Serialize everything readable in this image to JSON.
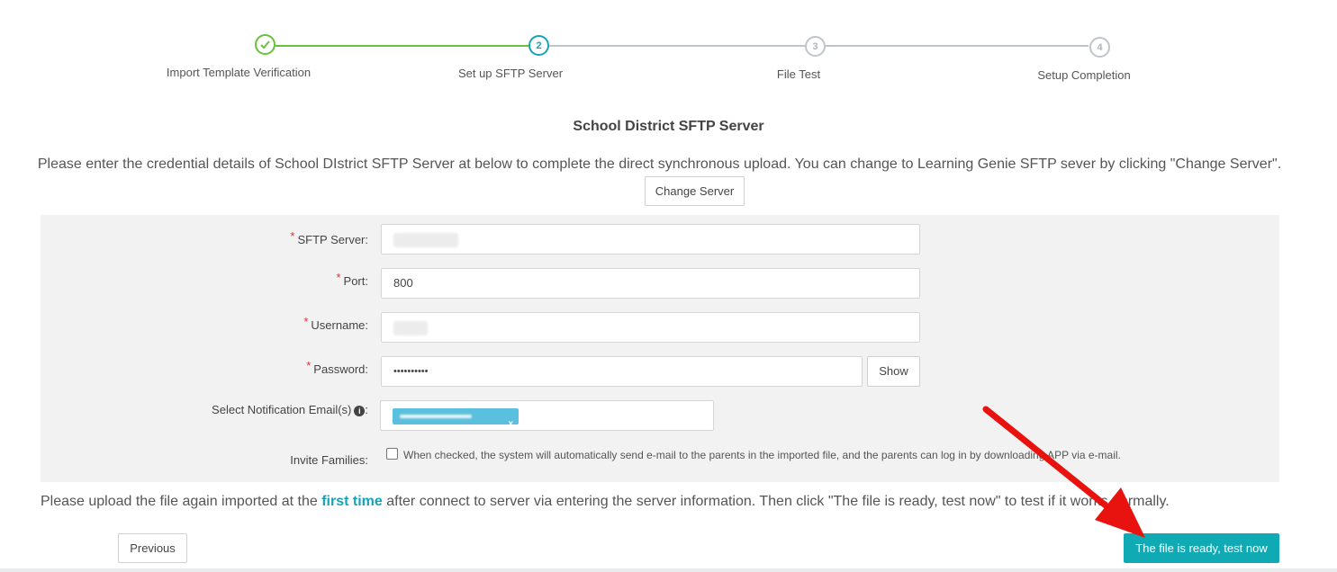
{
  "stepper": {
    "steps": [
      {
        "number": "",
        "label": "Import Template Verification",
        "state": "done"
      },
      {
        "number": "2",
        "label": "Set up SFTP Server",
        "state": "active"
      },
      {
        "number": "3",
        "label": "File Test",
        "state": "pending"
      },
      {
        "number": "4",
        "label": "Setup Completion",
        "state": "pending"
      }
    ],
    "colors": {
      "done": "#67c23a",
      "active": "#17a2b8",
      "pending": "#c0c4cc"
    }
  },
  "page": {
    "title": "School District SFTP Server",
    "description": "Please enter the credential details of School DIstrict SFTP Server at below to complete the direct synchronous upload. You can change to Learning Genie SFTP sever by clicking \"Change Server\".",
    "change_server_label": "Change Server"
  },
  "form": {
    "sftp_server": {
      "label": "SFTP Server:",
      "required": "*"
    },
    "port": {
      "label": "Port:",
      "required": "*",
      "value": "800"
    },
    "username": {
      "label": "Username:",
      "required": "*"
    },
    "password": {
      "label": "Password:",
      "required": "*",
      "value": "••••••••••",
      "show_label": "Show"
    },
    "notification": {
      "label": "Select Notification Email(s)",
      "info_icon": "i",
      "suffix": ":",
      "tag_close": "x"
    },
    "invite": {
      "label": "Invite Families",
      "suffix": ":",
      "checkbox_text": "When checked, the system will automatically send e-mail to the parents in the imported file, and the parents can log in by downloading APP via e-mail."
    }
  },
  "footer": {
    "note_before": "Please upload the file again imported at the ",
    "note_highlight": "first time",
    "note_after": " after connect to server via entering the server information. Then click \"The file is ready, test now\" to test if it works normally.",
    "previous_label": "Previous",
    "test_label": "The file is ready, test now"
  },
  "colors": {
    "accent": "#10aab5",
    "arrow": "#e8130e",
    "required": "#e03030"
  }
}
